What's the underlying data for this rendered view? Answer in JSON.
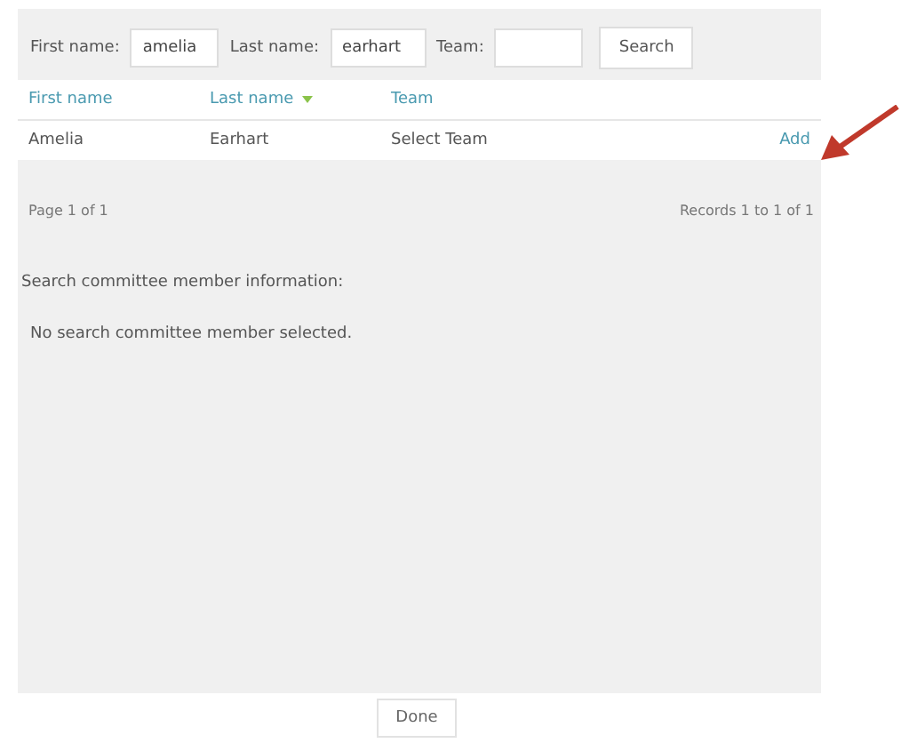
{
  "search_form": {
    "fields": [
      {
        "label": "First name:",
        "value": "amelia"
      },
      {
        "label": "Last name:",
        "value": "earhart"
      },
      {
        "label": "Team:"
      }
    ],
    "button": "Search"
  },
  "table": {
    "columns": [
      {
        "label": "First name",
        "sorted": false
      },
      {
        "label": "Last name",
        "sorted": true
      },
      {
        "label": "Team",
        "sorted": false
      }
    ],
    "rows": [
      {
        "cells": [
          "Amelia",
          "Earhart",
          "Select Team"
        ],
        "action": "Add"
      }
    ]
  },
  "pager": {
    "page": "Page 1 of 1",
    "records": "Records 1 to 1 of 1"
  },
  "info": {
    "title": "Search committee member information:",
    "message": "No search committee member selected."
  },
  "done_button": "Done"
}
